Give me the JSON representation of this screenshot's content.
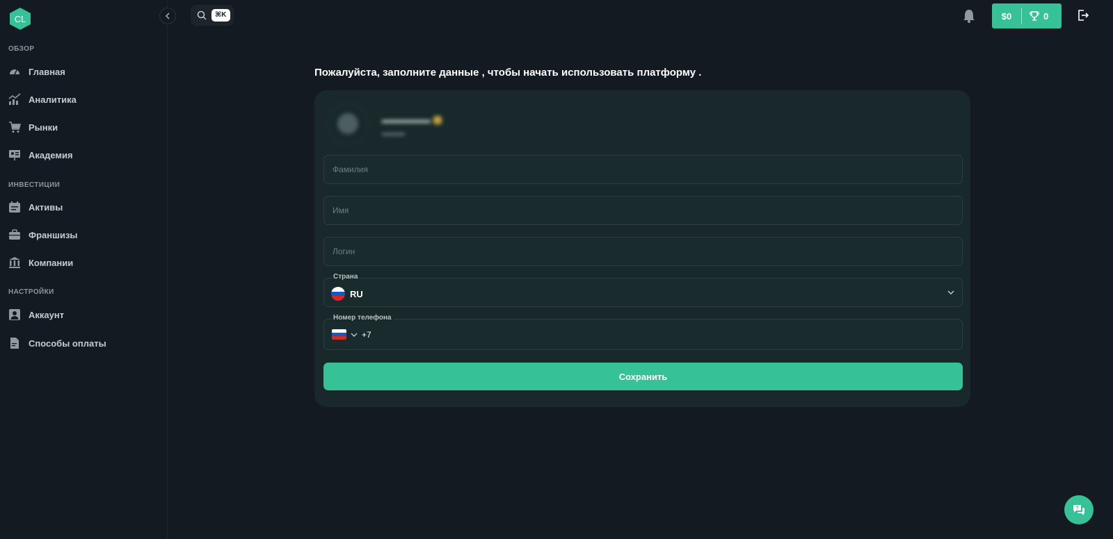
{
  "brand": {
    "logo_text": "CL",
    "accent": "#36c296"
  },
  "sidebar": {
    "sections": [
      {
        "title": "ОБЗОР",
        "items": [
          {
            "label": "Главная",
            "icon": "gauge-icon"
          },
          {
            "label": "Аналитика",
            "icon": "chart-icon"
          },
          {
            "label": "Рынки",
            "icon": "cart-icon"
          },
          {
            "label": "Академия",
            "icon": "presentation-icon"
          }
        ]
      },
      {
        "title": "ИНВЕСТИЦИИ",
        "items": [
          {
            "label": "Активы",
            "icon": "calendar-icon"
          },
          {
            "label": "Франшизы",
            "icon": "briefcase-icon"
          },
          {
            "label": "Компании",
            "icon": "bank-icon"
          }
        ]
      },
      {
        "title": "НАСТРОЙКИ",
        "items": [
          {
            "label": "Аккаунт",
            "icon": "user-icon"
          },
          {
            "label": "Способы оплаты",
            "icon": "document-icon"
          }
        ]
      }
    ]
  },
  "topbar": {
    "search_shortcut": "⌘K",
    "balance": "$0",
    "trophies": "0"
  },
  "main": {
    "title": "Пожалуйста, заполните данные , чтобы начать использовать платформу .",
    "form": {
      "lastname_placeholder": "Фамилия",
      "firstname_placeholder": "Имя",
      "login_placeholder": "Логин",
      "country_label": "Страна",
      "country_value": "RU",
      "phone_label": "Номер телефона",
      "phone_code": "+7",
      "save_label": "Сохранить"
    }
  }
}
